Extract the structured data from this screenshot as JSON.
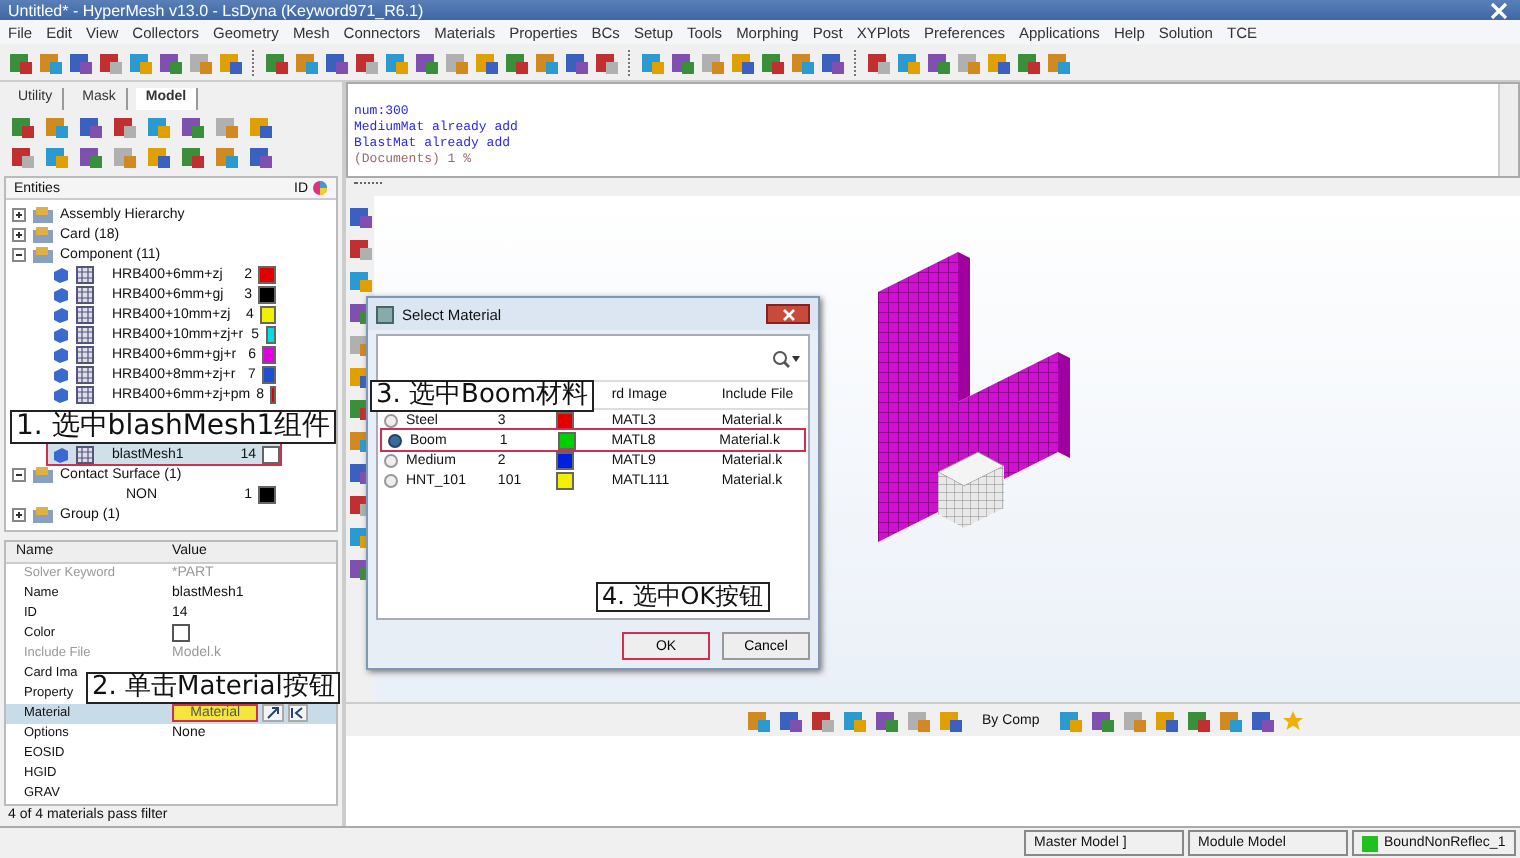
{
  "window": {
    "title": "Untitled* - HyperMesh v13.0 - LsDyna (Keyword971_R6.1)"
  },
  "menu": [
    "File",
    "Edit",
    "View",
    "Collectors",
    "Geometry",
    "Mesh",
    "Connectors",
    "Materials",
    "Properties",
    "BCs",
    "Setup",
    "Tools",
    "Morphing",
    "Post",
    "XYPlots",
    "Preferences",
    "Applications",
    "Help",
    "Solution",
    "TCE"
  ],
  "panel_tabs": [
    {
      "label": "Utility",
      "selected": false
    },
    {
      "label": "Mask",
      "selected": false
    },
    {
      "label": "Model",
      "selected": true
    }
  ],
  "entities": {
    "title": "Entities",
    "id_header": "ID",
    "tree": [
      {
        "label": "Assembly Hierarchy",
        "expanded": false
      },
      {
        "label": "Card (18)",
        "expanded": false
      },
      {
        "label": "Component (11)",
        "expanded": true,
        "children": [
          {
            "label": "HRB400+6mm+zj",
            "id": "2",
            "color": "#e00000",
            "selected": false,
            "highlighted": false
          },
          {
            "label": "HRB400+6mm+gj",
            "id": "3",
            "color": "#000000",
            "selected": false,
            "highlighted": false
          },
          {
            "label": "HRB400+10mm+zj",
            "id": "4",
            "color": "#f0f000",
            "selected": false,
            "highlighted": false
          },
          {
            "label": "HRB400+10mm+zj+r",
            "id": "5",
            "color": "#00e0e0",
            "selected": false,
            "highlighted": false
          },
          {
            "label": "HRB400+6mm+gj+r",
            "id": "6",
            "color": "#e000e0",
            "selected": false,
            "highlighted": false
          },
          {
            "label": "HRB400+8mm+zj+r",
            "id": "7",
            "color": "#2050d0",
            "selected": false,
            "highlighted": false
          },
          {
            "label": "HRB400+6mm+zj+pm",
            "id": "8",
            "color": "#e00000",
            "selected": false,
            "highlighted": false
          },
          {
            "label": "blastMesh1",
            "id": "14",
            "color": "#ffffff",
            "selected": true,
            "highlighted": true
          }
        ]
      },
      {
        "label": "Contact Surface (1)",
        "expanded": true,
        "children": [
          {
            "label": "NON",
            "id": "1",
            "color": "#000000",
            "selected": false,
            "highlighted": false
          }
        ]
      },
      {
        "label": "Group (1)",
        "expanded": false
      }
    ]
  },
  "properties": {
    "columns": [
      "Name",
      "Value"
    ],
    "rows": [
      {
        "kind": "text",
        "name": "Solver Keyword",
        "value": "*PART",
        "disabled": true,
        "selected": false
      },
      {
        "kind": "text",
        "name": "Name",
        "value": "blastMesh1",
        "disabled": false,
        "selected": false
      },
      {
        "kind": "text",
        "name": "ID",
        "value": "14",
        "disabled": false,
        "selected": false
      },
      {
        "kind": "swatch",
        "name": "Color",
        "disabled": false,
        "selected": false
      },
      {
        "kind": "text",
        "name": "Include File",
        "value": "Model.k",
        "disabled": true,
        "selected": false
      },
      {
        "kind": "text",
        "name": "Card Ima",
        "disabled": false,
        "selected": false
      },
      {
        "kind": "text",
        "name": "Property",
        "disabled": false,
        "selected": false
      },
      {
        "kind": "button",
        "name": "Material",
        "value": "Material",
        "disabled": false,
        "selected": true,
        "highlighted": true
      },
      {
        "kind": "text",
        "name": "Options",
        "value": "None",
        "disabled": false,
        "selected": false
      },
      {
        "kind": "text",
        "name": "EOSID",
        "disabled": false,
        "selected": false
      },
      {
        "kind": "text",
        "name": "HGID",
        "disabled": false,
        "selected": false
      },
      {
        "kind": "text",
        "name": "GRAV",
        "disabled": false,
        "selected": false
      }
    ]
  },
  "panel_status": "4 of 4 materials pass filter",
  "console": {
    "lines": [
      {
        "text": "num:300",
        "kind": "output"
      },
      {
        "text": "MediumMat already add",
        "kind": "output"
      },
      {
        "text": "BlastMat already add",
        "kind": "output"
      },
      {
        "text": "(Documents) 1 %",
        "kind": "prompt"
      }
    ]
  },
  "view_toolbar": {
    "color_mode": "By Comp"
  },
  "dialog": {
    "title": "Select Material",
    "columns": [
      "rd Image",
      "Include File"
    ],
    "rows": [
      {
        "name": "Steel",
        "id": "3",
        "color": "#e00000",
        "card": "MATL3",
        "file": "Material.k",
        "selected": false,
        "highlighted": false
      },
      {
        "name": "Boom",
        "id": "1",
        "color": "#00d000",
        "card": "MATL8",
        "file": "Material.k",
        "selected": true,
        "highlighted": true
      },
      {
        "name": "Medium",
        "id": "2",
        "color": "#0020e0",
        "card": "MATL9",
        "file": "Material.k",
        "selected": false,
        "highlighted": false
      },
      {
        "name": "HNT_101",
        "id": "101",
        "color": "#f0f000",
        "card": "MATL111",
        "file": "Material.k",
        "selected": false,
        "highlighted": false
      }
    ],
    "buttons": [
      {
        "label": "OK",
        "highlighted": true
      },
      {
        "label": "Cancel",
        "highlighted": false
      }
    ]
  },
  "annotations": [
    {
      "text": "1. 选中blashMesh1组件"
    },
    {
      "text": "2. 单击Material按钮"
    },
    {
      "text": "3. 选中Boom材料"
    },
    {
      "text": "4. 选中OK按钮"
    }
  ],
  "status_bar": {
    "segments": [
      "Master Model ]",
      "Module Model",
      "BoundNonReflec_1"
    ]
  }
}
